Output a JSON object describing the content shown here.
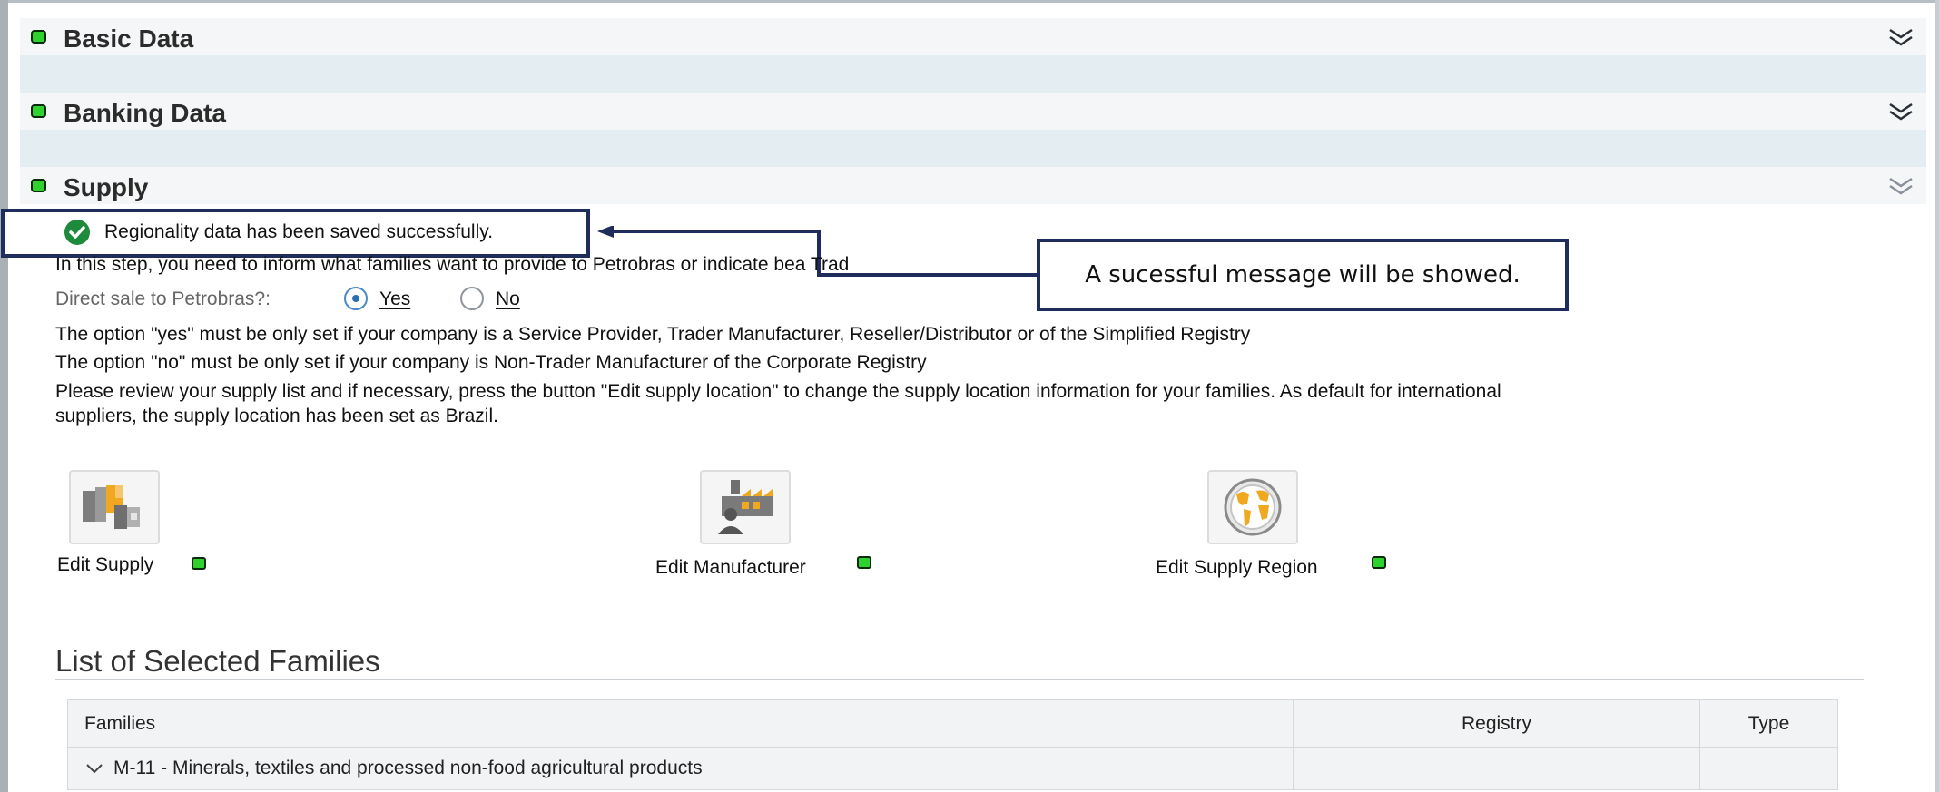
{
  "sections": [
    {
      "title": "Basic Data"
    },
    {
      "title": "Banking Data"
    },
    {
      "title": "Supply"
    }
  ],
  "supply": {
    "success_message": "Regionality data has been saved successfully.",
    "intro": "In this step, you need to inform what families want to provide to Petrobras or indicate bea Trad",
    "direct_sale_label": "Direct sale to Petrobras?:",
    "option_yes": "Yes",
    "option_no": "No",
    "selected_option": "Yes",
    "note_yes": "The option \"yes\" must be only set if your company is a Service Provider, Trader Manufacturer, Reseller/Distributor or of the Simplified Registry",
    "note_no": "The option \"no\" must be only set if your company is Non-Trader Manufacturer of the Corporate Registry",
    "review_line1": "Please review your supply list and if necessary, press the button \"Edit supply location\" to change the supply location information for your families. As default for international",
    "review_line2": "suppliers, the supply location has been set as Brazil.",
    "actions": [
      {
        "label": "Edit Supply",
        "icon": "supply-icon"
      },
      {
        "label": "Edit Manufacturer",
        "icon": "manufacturer-icon"
      },
      {
        "label": "Edit Supply Region",
        "icon": "globe-icon"
      }
    ]
  },
  "annotation": {
    "callout_text": "A sucessful message will be showed."
  },
  "families": {
    "title": "List of Selected Families",
    "columns": [
      "Families",
      "Registry",
      "Type"
    ],
    "rows": [
      {
        "family": "M-11 - Minerals, textiles and processed non-food agricultural products",
        "registry": "",
        "type": ""
      }
    ]
  },
  "colors": {
    "status_green": "#2fd12f",
    "annotation_border": "#1f2d5c",
    "radio_selected": "#2a6fb5"
  }
}
